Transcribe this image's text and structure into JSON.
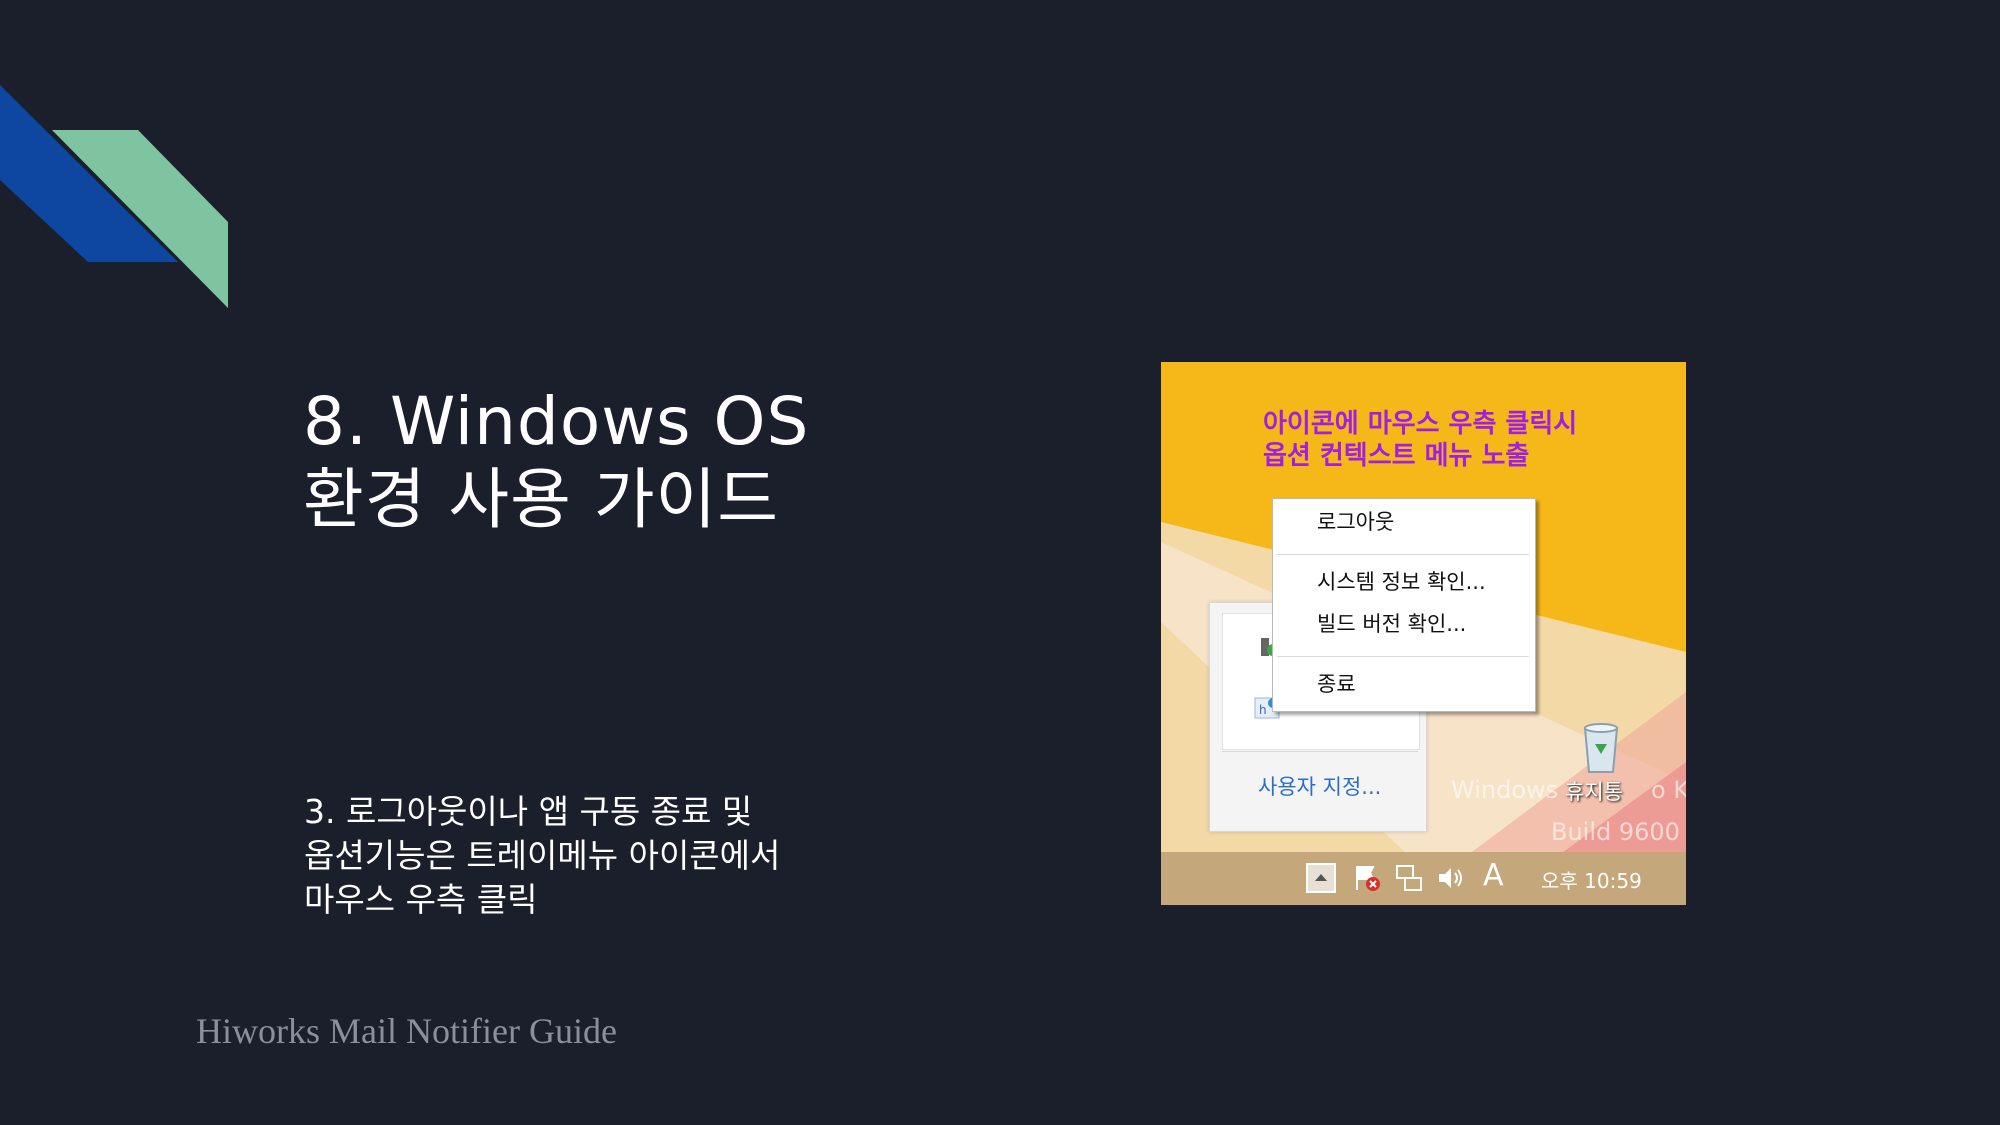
{
  "slide": {
    "title_line1": "8. Windows OS",
    "title_line2": "환경 사용 가이드",
    "body_line1": "3. 로그아웃이나 앱 구동 종료 및",
    "body_line2": "옵션기능은 트레이메뉴 아이콘에서",
    "body_line3": "마우스 우측 클릭",
    "footer": "Hiworks Mail Notifier Guide"
  },
  "colors": {
    "background": "#1b1f2b",
    "accent_blue": "#0d47a1",
    "accent_green": "#7fc4a0",
    "annotation": "#a020e0"
  },
  "screenshot": {
    "annotation_line1": "아이콘에 마우스 우측 클릭시",
    "annotation_line2": "옵션 컨텍스트 메뉴 노출",
    "context_menu": {
      "items": [
        {
          "label": "로그아웃"
        },
        {
          "label": "시스템 정보 확인..."
        },
        {
          "label": "빌드 버전 확인..."
        },
        {
          "label": "종료"
        }
      ]
    },
    "tray_popup": {
      "customize_label": "사용자 지정..."
    },
    "desktop": {
      "watermark_line1": "Windows",
      "watermark_line1_tail": "o K",
      "watermark_line2": "Build 9600",
      "recycle_bin_label": "휴지통"
    },
    "taskbar": {
      "ime_indicator": "A",
      "clock": "오후 10:59",
      "icons": [
        "show-hidden-icons-icon",
        "action-center-flag-icon",
        "network-icon",
        "volume-icon"
      ]
    }
  }
}
